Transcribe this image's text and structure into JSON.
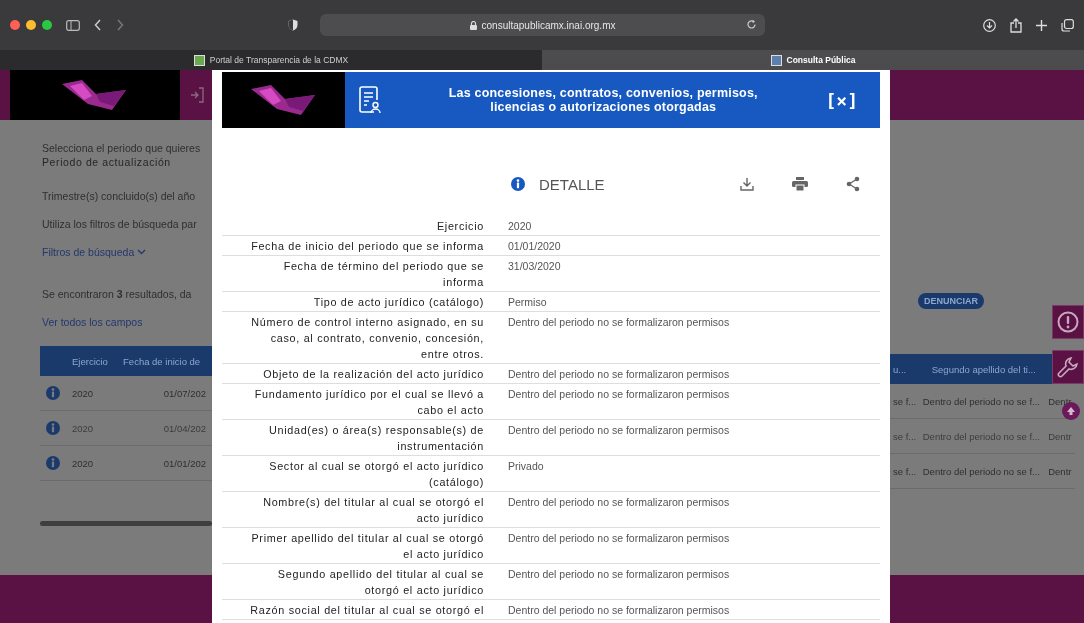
{
  "browser": {
    "address": "consultapublicamx.inai.org.mx"
  },
  "tabs": [
    {
      "label": "Portal de Transparencia de la CDMX",
      "selected": false
    },
    {
      "label": "Consulta Pública",
      "selected": true
    }
  ],
  "page": {
    "intro": "Selecciona el periodo que quieres",
    "period_label": "Periodo de actualización",
    "quarters": "Trimestre(s) concluido(s) del año",
    "filters_hint": "Utiliza los filtros de búsqueda par",
    "filters_link": "Filtros de búsqueda",
    "results": "Se encontraron **3** resultados, da",
    "all_fields_link": "Ver todos los campos",
    "report_button": "DENUNCIAR",
    "table_left": {
      "columns": [
        "Ejercicio",
        "Fecha de inicio de"
      ],
      "rows": [
        [
          "2020",
          "01/07/202"
        ],
        [
          "2020",
          "01/04/202"
        ],
        [
          "2020",
          "01/01/202"
        ]
      ]
    },
    "table_right": {
      "columns": [
        "u...",
        "Segundo apellido del ti..."
      ],
      "rows": [
        [
          "se f...",
          "Dentro del periodo no se f...",
          "Dentr"
        ],
        [
          "se f...",
          "Dentro del periodo no se f...",
          "Dentr"
        ],
        [
          "se f...",
          "Dentro del periodo no se f...",
          "Dentr"
        ]
      ]
    }
  },
  "modal": {
    "title": "Las concesiones, contratos, convenios, permisos, licencias o autorizaciones otorgadas",
    "close_label": "[×]",
    "section": "DETALLE",
    "fields": [
      {
        "label": "Ejercicio",
        "value": "2020"
      },
      {
        "label": "Fecha de inicio del periodo que se informa",
        "value": "01/01/2020"
      },
      {
        "label": "Fecha de término del periodo que se informa",
        "value": "31/03/2020"
      },
      {
        "label": "Tipo de acto jurídico (catálogo)",
        "value": "Permiso"
      },
      {
        "label": "Número de control interno asignado, en su caso, al contrato, convenio, concesión, entre otros.",
        "value": "Dentro del periodo no se formalizaron permisos"
      },
      {
        "label": "Objeto de la realización del acto jurídico",
        "value": "Dentro del periodo no se formalizaron permisos"
      },
      {
        "label": "Fundamento jurídico por el cual se llevó a cabo el acto",
        "value": "Dentro del periodo no se formalizaron permisos"
      },
      {
        "label": "Unidad(es) o área(s) responsable(s) de instrumentación",
        "value": "Dentro del periodo no se formalizaron permisos"
      },
      {
        "label": "Sector al cual se otorgó el acto jurídico (catálogo)",
        "value": "Privado"
      },
      {
        "label": "Nombre(s) del titular al cual se otorgó el acto jurídico",
        "value": "Dentro del periodo no se formalizaron permisos"
      },
      {
        "label": "Primer apellido del titular al cual se otorgó el acto jurídico",
        "value": "Dentro del periodo no se formalizaron permisos"
      },
      {
        "label": "Segundo apellido del titular al cual se otorgó el acto jurídico",
        "value": "Dentro del periodo no se formalizaron permisos"
      },
      {
        "label": "Razón social del titular al cual se otorgó el",
        "value": "Dentro del periodo no se formalizaron permisos"
      }
    ]
  }
}
